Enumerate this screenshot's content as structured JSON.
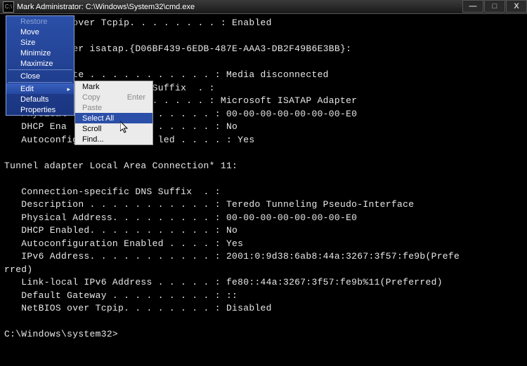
{
  "titlebar": {
    "icon_text": "C:\\",
    "title": "Mark Administrator: C:\\Windows\\System32\\cmd.exe",
    "min_glyph": "—",
    "max_glyph": "□",
    "close_glyph": "X"
  },
  "console_lines": [
    "            over Tcpip. . . . . . . . : Enabled",
    "",
    "           ter isatap.{D06BF439-6EDB-487E-AAA3-DB2F49B6E3BB}:",
    "",
    "           ate . . . . . . . . . . . : Media disconnected",
    "           n-specific DNS Suffix  . :",
    "           on . . . . . . . . . . . : Microsoft ISATAP Adapter",
    "   Physical        . . . . . . . . . : 00-00-00-00-00-00-00-E0",
    "   DHCP Ena        . . . . . . . . . : No",
    "   Autoconfiguration       led . . . . : Yes",
    "",
    "Tunnel adapter Local Area Connection* 11:",
    "",
    "   Connection-specific DNS Suffix  . :",
    "   Description . . . . . . . . . . . : Teredo Tunneling Pseudo-Interface",
    "   Physical Address. . . . . . . . . : 00-00-00-00-00-00-00-E0",
    "   DHCP Enabled. . . . . . . . . . . : No",
    "   Autoconfiguration Enabled . . . . : Yes",
    "   IPv6 Address. . . . . . . . . . . : 2001:0:9d38:6ab8:44a:3267:3f57:fe9b(Prefe",
    "rred)",
    "   Link-local IPv6 Address . . . . . : fe80::44a:3267:3f57:fe9b%11(Preferred)",
    "   Default Gateway . . . . . . . . . : ::",
    "   NetBIOS over Tcpip. . . . . . . . : Disabled",
    "",
    "C:\\Windows\\system32>"
  ],
  "system_menu": {
    "items": [
      {
        "label": "Restore",
        "disabled": true
      },
      {
        "label": "Move",
        "disabled": false
      },
      {
        "label": "Size",
        "disabled": false
      },
      {
        "label": "Minimize",
        "disabled": false
      },
      {
        "label": "Maximize",
        "disabled": false
      },
      {
        "sep": true
      },
      {
        "label": "Close",
        "disabled": false
      },
      {
        "sep": true
      },
      {
        "label": "Edit",
        "disabled": false,
        "has_sub": true,
        "highlighted": true
      },
      {
        "label": "Defaults",
        "disabled": false
      },
      {
        "label": "Properties",
        "disabled": false
      }
    ]
  },
  "edit_submenu": {
    "items": [
      {
        "label": "Mark",
        "disabled": false
      },
      {
        "label": "Copy",
        "disabled": true,
        "shortcut": "Enter"
      },
      {
        "label": "Paste",
        "disabled": true
      },
      {
        "label": "Select All",
        "disabled": false,
        "highlighted": true
      },
      {
        "label": "Scroll",
        "disabled": false
      },
      {
        "label": "Find...",
        "disabled": false
      }
    ]
  }
}
